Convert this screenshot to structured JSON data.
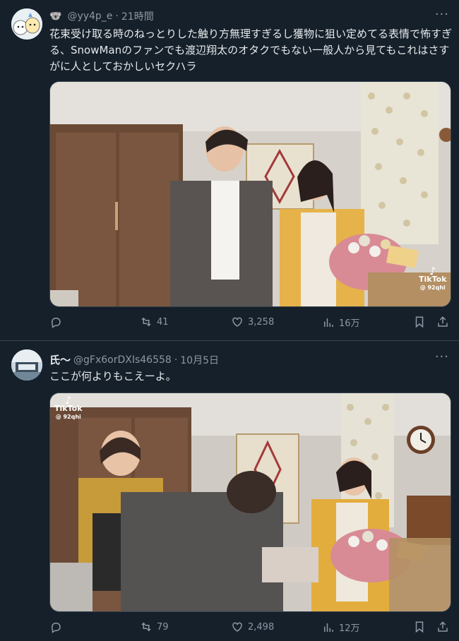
{
  "tweets": [
    {
      "display_name": "",
      "handle": "@yy4p_e",
      "separator": "·",
      "time": "21時間",
      "text": "花束受け取る時のねっとりした触り方無理すぎるし獲物に狙い定めてる表情で怖すぎる、SnowManのファンでも渡辺翔太のオタクでもない一般人から見てもこれはさすがに人としておかしいセクハラ",
      "watermark": {
        "brand": "TikTok",
        "user": "@ 92qhi"
      },
      "replies": "",
      "retweets": "41",
      "likes": "3,258",
      "views": "16万"
    },
    {
      "display_name": "氏〜",
      "handle": "@gFx6orDXIs46558",
      "separator": "·",
      "time": "10月5日",
      "text": "ここが何よりもこえーよ。",
      "watermark": {
        "brand": "TikTok",
        "user": "@ 92qhi"
      },
      "replies": "",
      "retweets": "79",
      "likes": "2,498",
      "views": "12万"
    }
  ],
  "icons": {
    "more": "more-icon",
    "reply": "reply-icon",
    "retweet": "retweet-icon",
    "like": "heart-icon",
    "views": "views-icon",
    "bookmark": "bookmark-icon",
    "share": "share-icon",
    "verified_emoji": "koala-emoji"
  },
  "colors": {
    "background": "#15202b",
    "text": "#e7e9ea",
    "muted": "#8b98a5",
    "border": "#38444d"
  }
}
